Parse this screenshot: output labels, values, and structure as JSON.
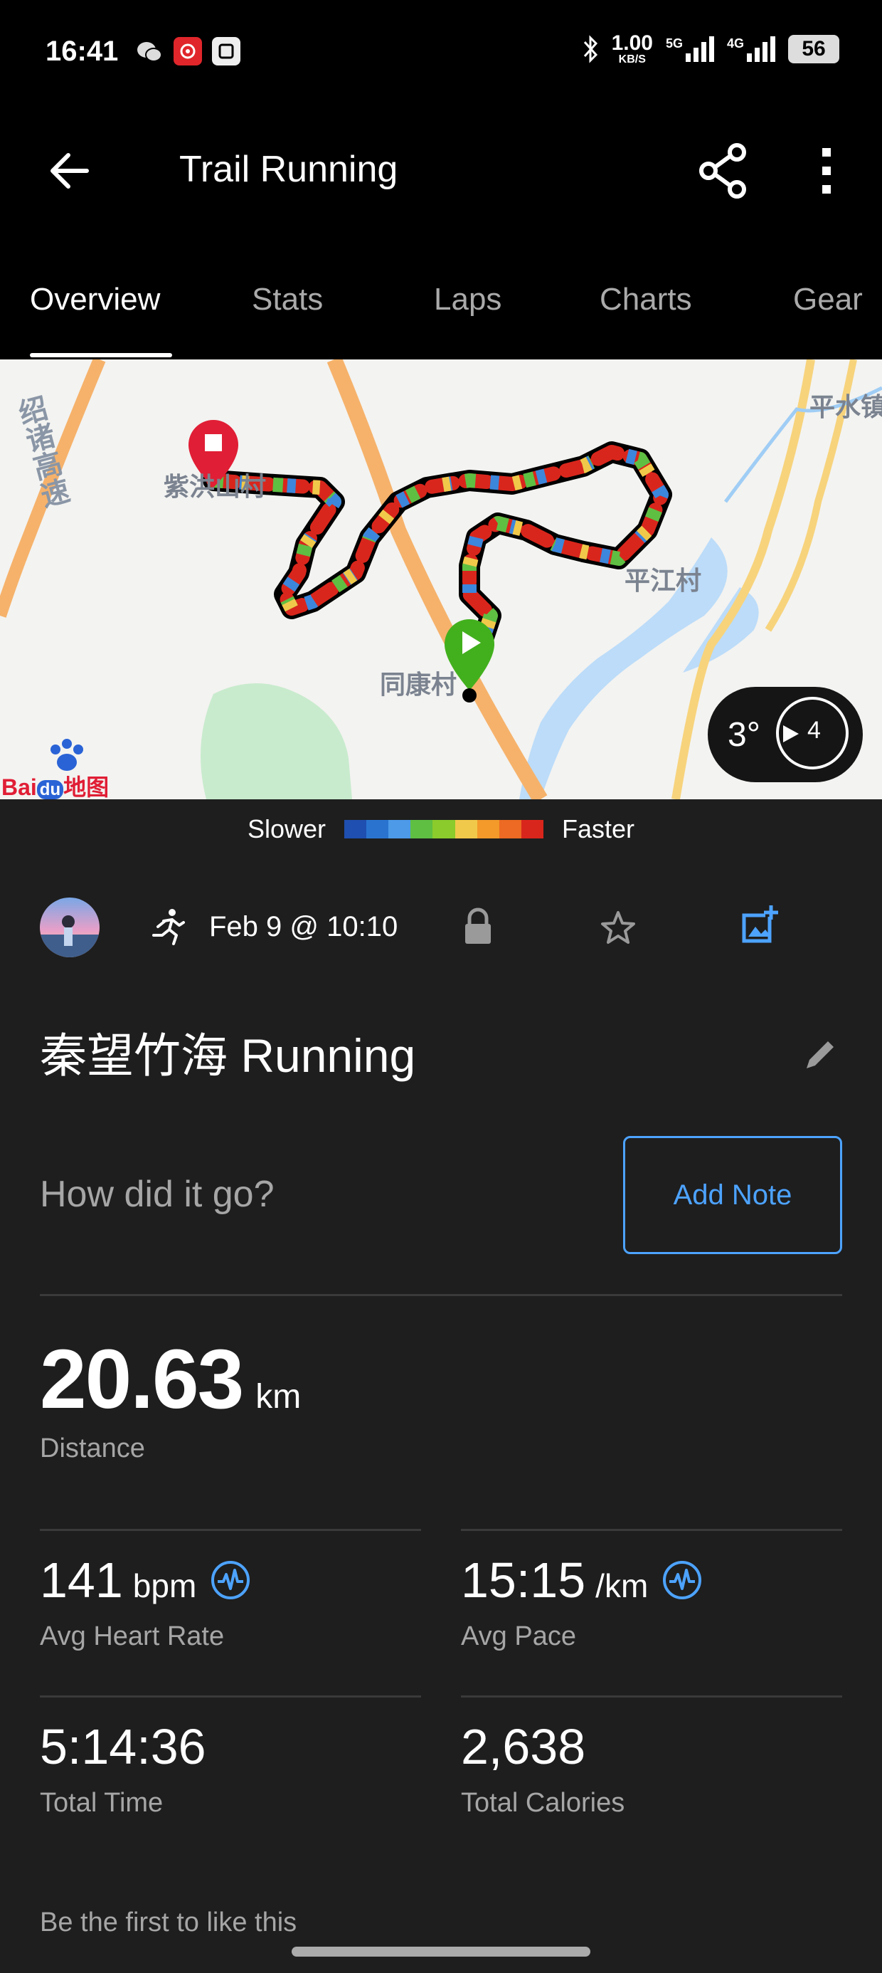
{
  "status_bar": {
    "time": "16:41",
    "netspeed_value": "1.00",
    "netspeed_unit": "KB/S",
    "signal1_label": "5G",
    "signal2_label": "4G",
    "battery": "56",
    "icons": [
      "wechat-icon",
      "netease-music-icon",
      "app-icon",
      "bluetooth-icon",
      "signal-icon",
      "battery-icon"
    ]
  },
  "header": {
    "title": "Trail Running",
    "back_icon": "arrow-left-icon",
    "share_icon": "share-icon",
    "more_icon": "more-vertical-icon"
  },
  "tabs": [
    "Overview",
    "Stats",
    "Laps",
    "Charts",
    "Gear"
  ],
  "active_tab": 0,
  "map": {
    "labels": {
      "expressway": "绍诸高速",
      "village_top": "紫洪山村",
      "village_right": "平江村",
      "village_start": "同康村",
      "place_corner": "平水镇",
      "baidu_brand": "Bai",
      "baidu_du": "du",
      "baidu_map": "地图"
    },
    "compass": {
      "angle": "3°",
      "number": "4"
    }
  },
  "legend": {
    "slower": "Slower",
    "faster": "Faster",
    "colors": [
      "#1f4fb0",
      "#2a74d0",
      "#4c9ae8",
      "#5fbf43",
      "#8bcb2c",
      "#f1c94a",
      "#f39a2a",
      "#ec6a23",
      "#d9261c"
    ]
  },
  "activity": {
    "date": "Feb 9 @ 10:10",
    "title": "秦望竹海 Running",
    "note_prompt": "How did it go?",
    "add_note": "Add Note"
  },
  "stats": {
    "distance": {
      "value": "20.63",
      "unit": "km",
      "label": "Distance"
    },
    "avg_hr": {
      "value": "141",
      "unit": "bpm",
      "label": "Avg Heart Rate"
    },
    "avg_pace": {
      "value": "15:15",
      "unit": "/km",
      "label": "Avg Pace"
    },
    "total_time": {
      "value": "5:14:36",
      "label": "Total Time"
    },
    "calories": {
      "value": "2,638",
      "label": "Total Calories"
    }
  },
  "likes_text": "Be the first to like this"
}
